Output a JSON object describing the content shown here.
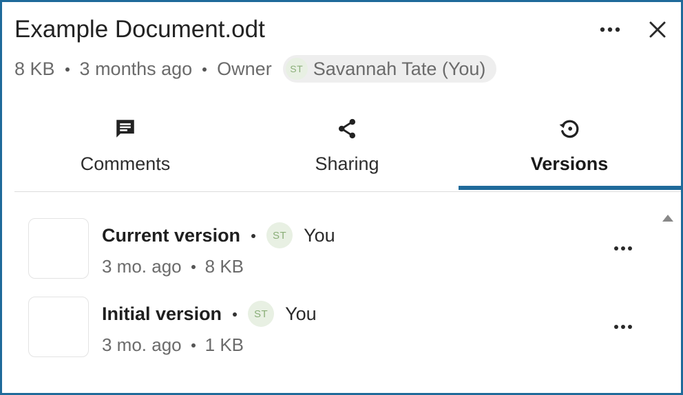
{
  "header": {
    "title": "Example Document.odt",
    "more_icon": "more-horizontal-icon",
    "close_icon": "close-icon"
  },
  "meta": {
    "size": "8 KB",
    "modified": "3 months ago",
    "owner_label": "Owner",
    "owner": {
      "initials": "ST",
      "name": "Savannah Tate (You)"
    }
  },
  "tabs": [
    {
      "label": "Comments",
      "icon": "comment-icon",
      "active": false
    },
    {
      "label": "Sharing",
      "icon": "share-icon",
      "active": false
    },
    {
      "label": "Versions",
      "icon": "history-icon",
      "active": true
    }
  ],
  "versions": [
    {
      "name": "Current version",
      "author_initials": "ST",
      "author": "You",
      "age": "3 mo. ago",
      "size": "8 KB"
    },
    {
      "name": "Initial version",
      "author_initials": "ST",
      "author": "You",
      "age": "3 mo. ago",
      "size": "1 KB"
    }
  ],
  "colors": {
    "accent": "#1f6a9a",
    "avatar_bg": "#e8f0e3",
    "avatar_text": "#8aae78",
    "chip_bg": "#eeeeee"
  }
}
